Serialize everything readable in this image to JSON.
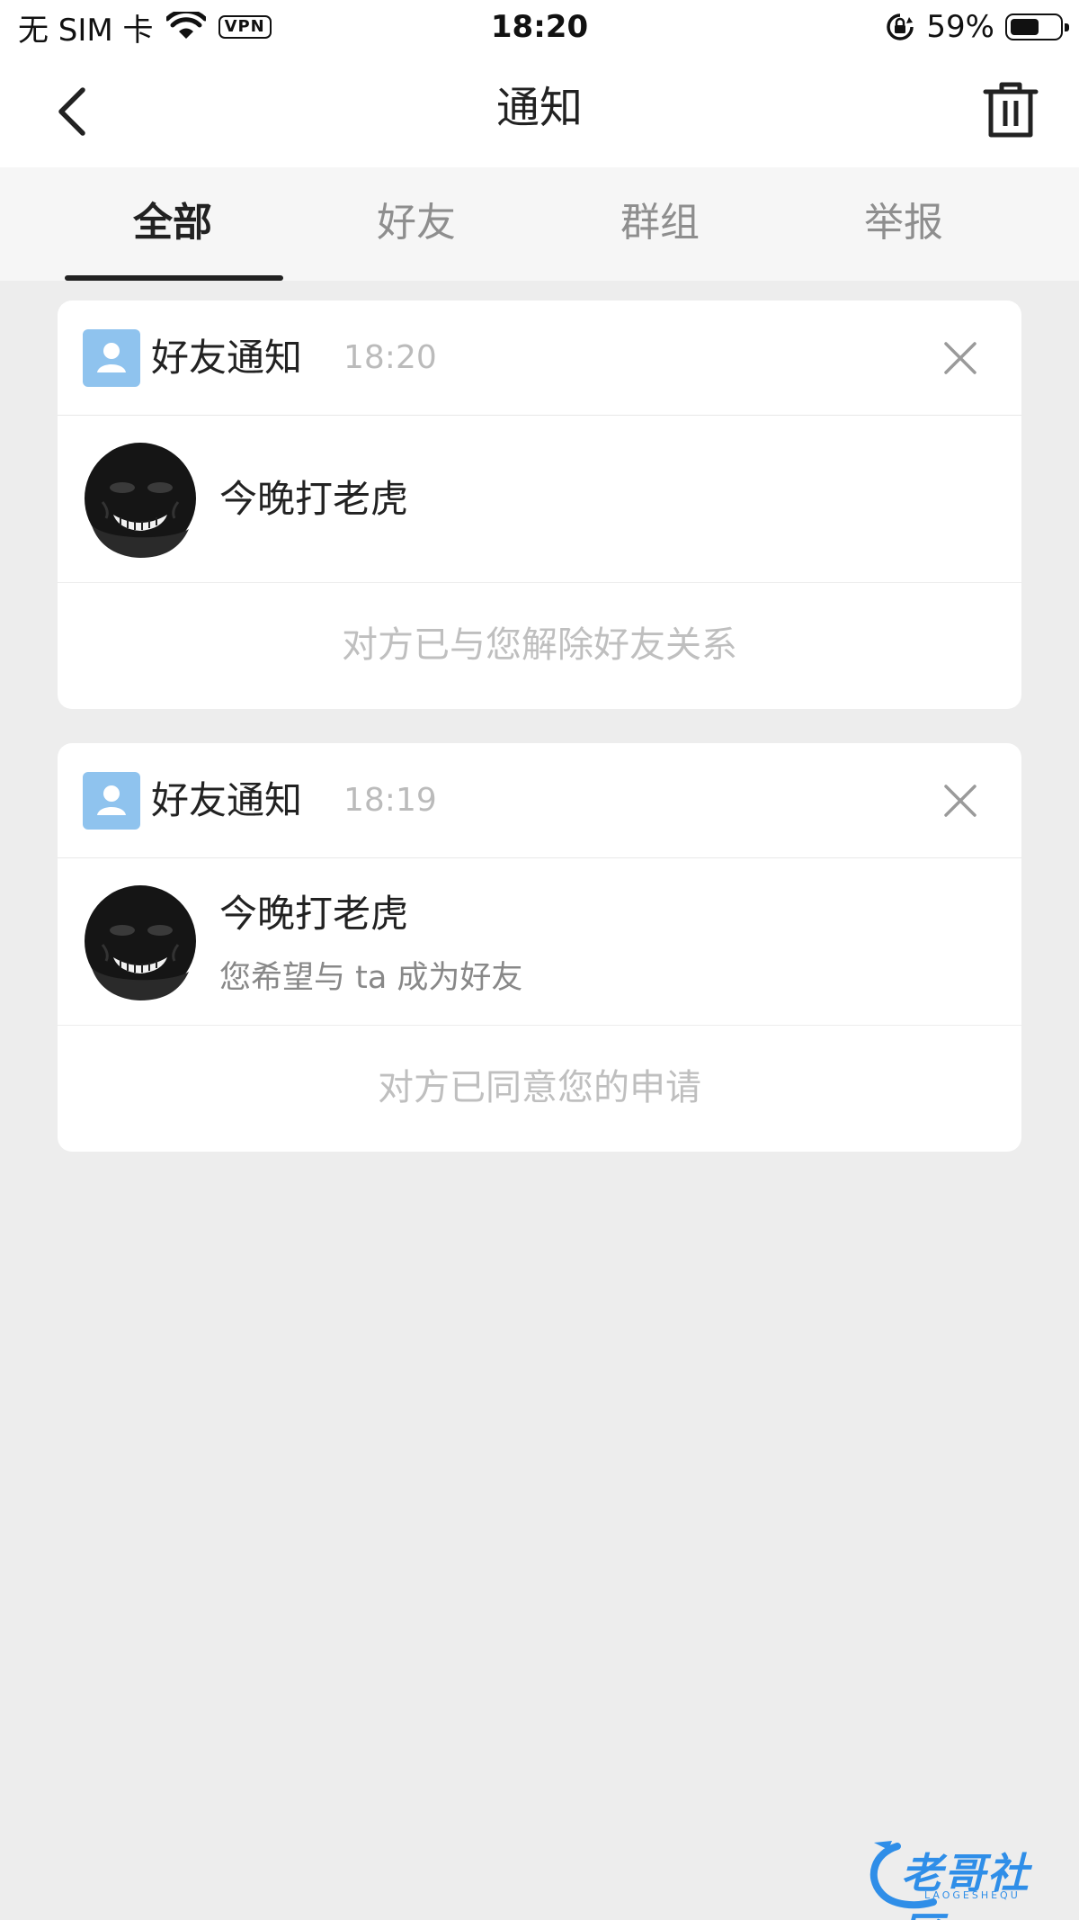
{
  "status_bar": {
    "carrier": "无 SIM 卡",
    "vpn": "VPN",
    "time": "18:20",
    "battery_percent": "59%",
    "battery_level": 0.59,
    "icons": [
      "wifi-icon",
      "vpn-badge",
      "orientation-lock-icon",
      "battery-icon"
    ]
  },
  "nav": {
    "title": "通知",
    "back_icon": "chevron-left-icon",
    "action_icon": "trash-icon"
  },
  "tabs": [
    {
      "label": "全部",
      "active": true
    },
    {
      "label": "好友",
      "active": false
    },
    {
      "label": "群组",
      "active": false
    },
    {
      "label": "举报",
      "active": false
    }
  ],
  "notifications": [
    {
      "type_label": "好友通知",
      "time": "18:20",
      "user_name": "今晚打老虎",
      "message": "",
      "status": "对方已与您解除好友关系"
    },
    {
      "type_label": "好友通知",
      "time": "18:19",
      "user_name": "今晚打老虎",
      "message": "您希望与 ta 成为好友",
      "status": "对方已同意您的申请"
    }
  ],
  "watermark": {
    "text": "老哥社区",
    "sub": "LAOGESHEQU"
  },
  "colors": {
    "background": "#ededed",
    "card": "#ffffff",
    "tab_bar": "#f6f6f6",
    "icon_blue": "#8fc3ee",
    "watermark_blue": "#2f8ee8"
  }
}
